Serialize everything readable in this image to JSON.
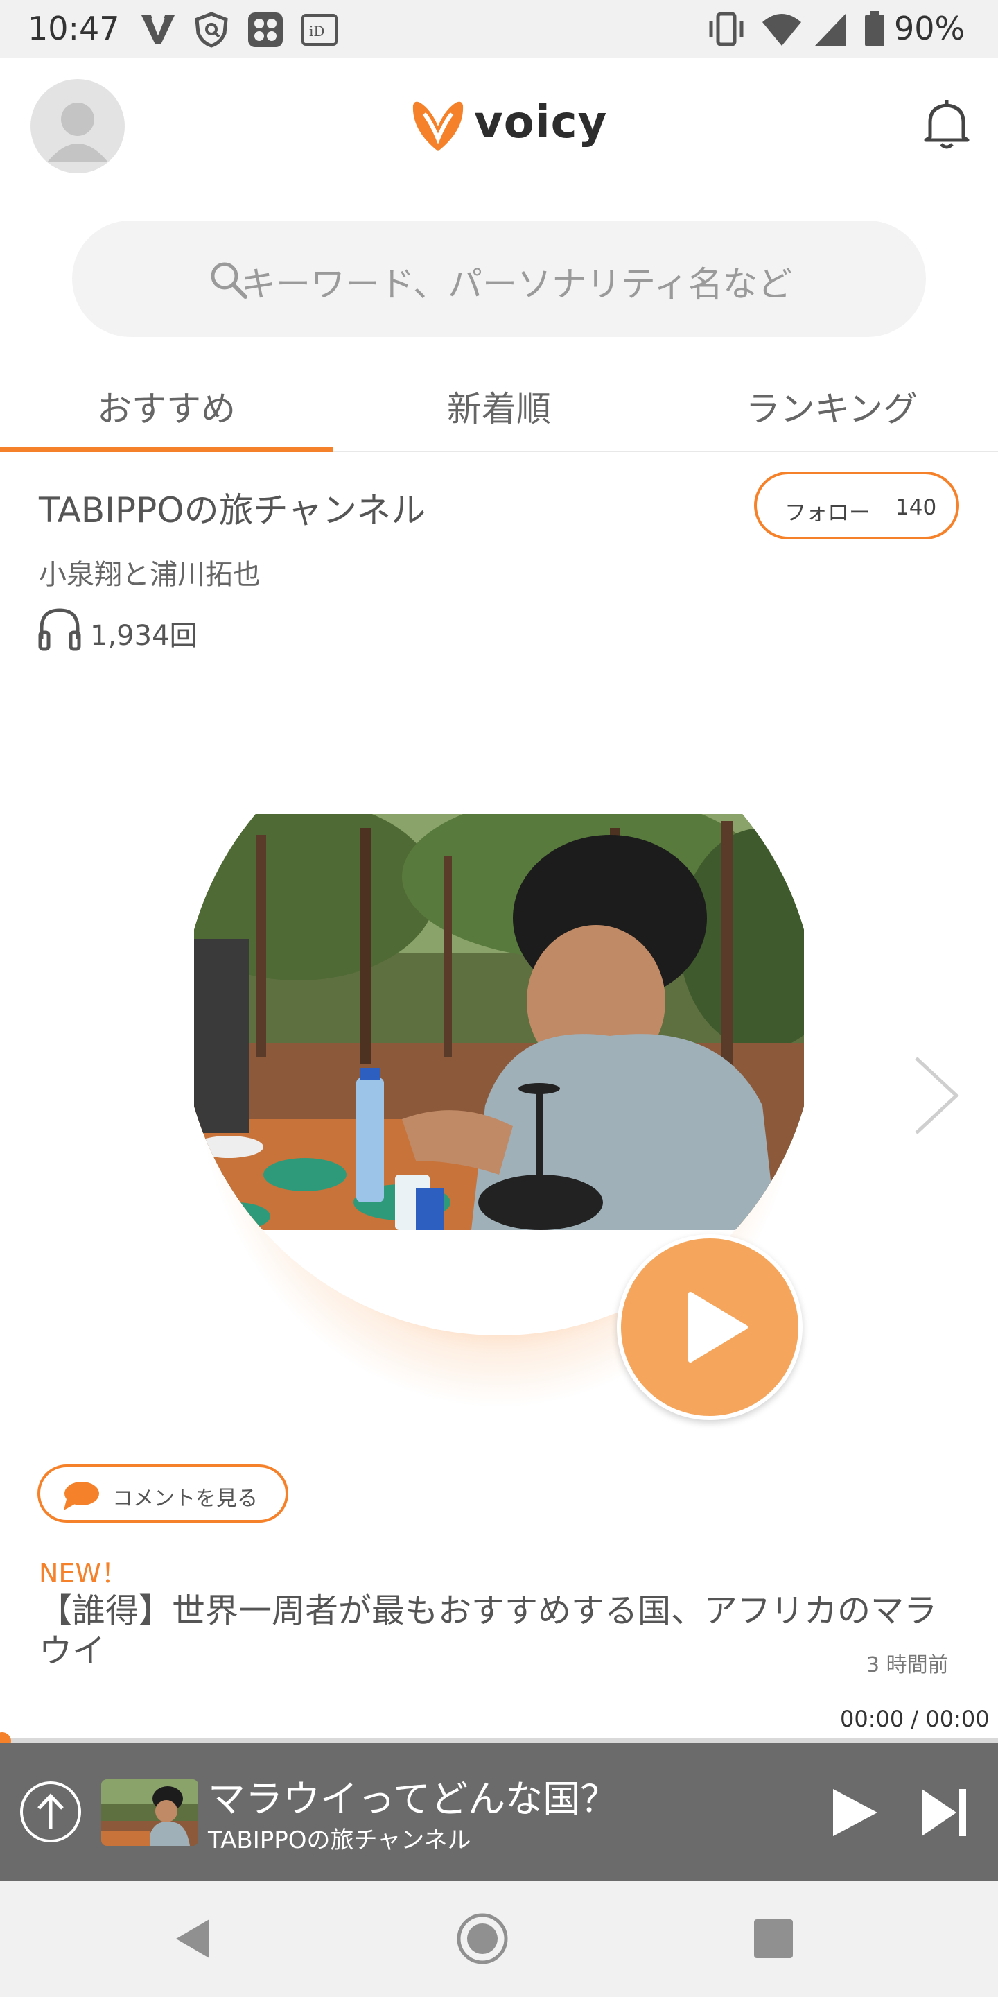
{
  "status_bar": {
    "time": "10:47",
    "battery_percent": "90%",
    "icons": [
      "voicy-notification-icon",
      "vpn-shield-icon",
      "app-grid-icon",
      "id-icon",
      "vibrate-icon",
      "wifi-icon",
      "cell-signal-icon",
      "battery-icon"
    ]
  },
  "header": {
    "logo_text": "voicy",
    "avatar_icon": "user-avatar-icon",
    "bell_icon": "bell-icon"
  },
  "search": {
    "placeholder": "キーワード、パーソナリティ名など"
  },
  "tabs": [
    {
      "label": "おすすめ",
      "active": true
    },
    {
      "label": "新着順",
      "active": false
    },
    {
      "label": "ランキング",
      "active": false
    }
  ],
  "channel": {
    "title": "TABIPPOの旅チャンネル",
    "personality": "小泉翔と浦川拓也",
    "play_count": "1,934回",
    "follow_label": "フォロー",
    "follow_count": "140"
  },
  "episode": {
    "comment_label": "コメントを見る",
    "new_badge": "NEW！",
    "title": "【誰得】世界一周者が最もおすすめする国、アフリカのマラウイ",
    "published": "3 時間前",
    "progress_time": "00:00 / 00:00",
    "progress": 0
  },
  "mini_player": {
    "title": "マラウイってどんな国？",
    "channel": "TABIPPOの旅チャンネル"
  },
  "colors": {
    "accent": "#f5822a",
    "play_button": "#f6a65c",
    "mini_player_bg": "#6b6b6b"
  }
}
